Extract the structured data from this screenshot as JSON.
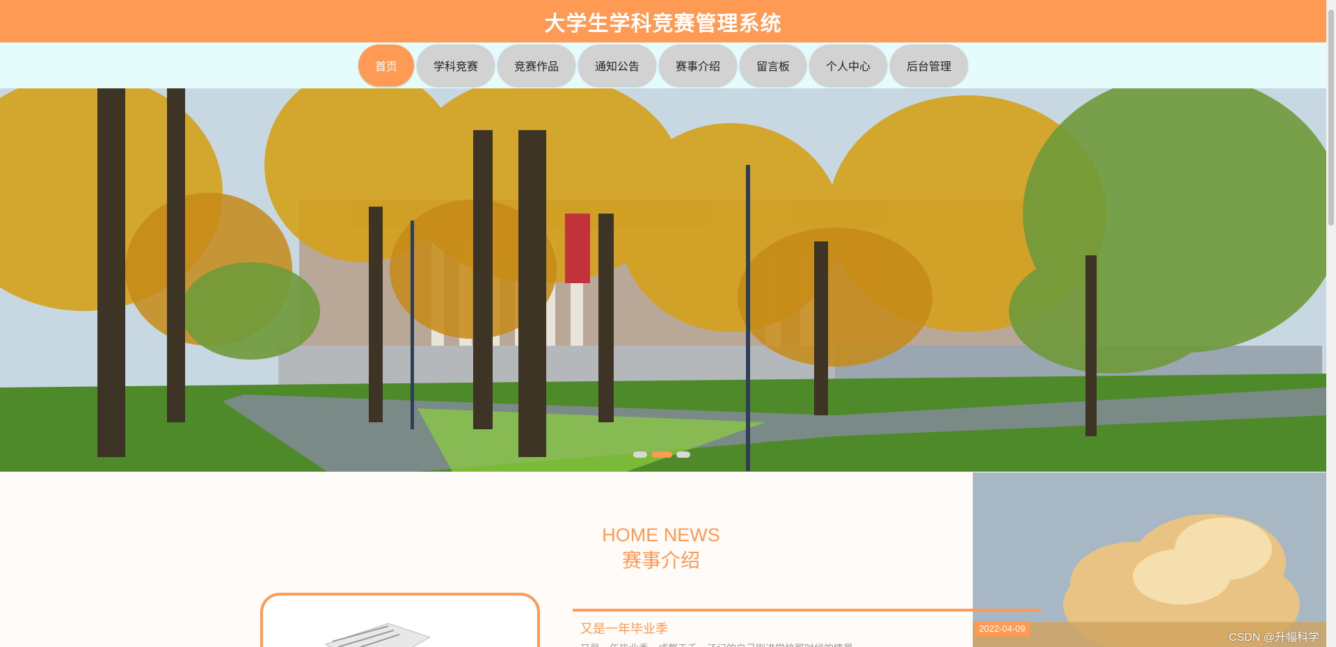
{
  "header": {
    "title": "大学生学科竞赛管理系统"
  },
  "nav": {
    "items": [
      {
        "label": "首页",
        "active": true
      },
      {
        "label": "学科竞赛"
      },
      {
        "label": "竞赛作品"
      },
      {
        "label": "通知公告"
      },
      {
        "label": "赛事介绍"
      },
      {
        "label": "留言板"
      },
      {
        "label": "个人中心"
      },
      {
        "label": "后台管理"
      }
    ]
  },
  "banner": {
    "slide_count": 3,
    "active_slide": 2
  },
  "news": {
    "heading_en": "HOME NEWS",
    "heading_zh": "赛事介绍",
    "item": {
      "title": "又是一年毕业季",
      "date": "2022-04-09",
      "excerpt": "又是一年毕业季，成群于千，还记的自己刚进学校那时候的情景，"
    }
  },
  "watermark": "CSDN @升幅科学",
  "colors": {
    "accent": "#ff9a55",
    "nav_bg": "#e6fbfb",
    "nav_item": "#d2d2d2"
  }
}
